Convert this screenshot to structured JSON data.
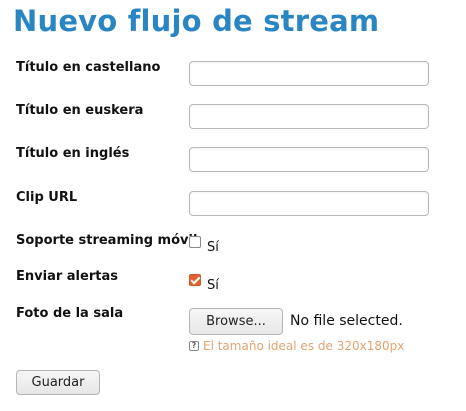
{
  "title": "Nuevo flujo de stream",
  "fields": {
    "titulo_castellano": {
      "label": "Título en castellano",
      "value": ""
    },
    "titulo_euskera": {
      "label": "Título en euskera",
      "value": ""
    },
    "titulo_ingles": {
      "label": "Título en inglés",
      "value": ""
    },
    "clip_url": {
      "label": "Clip URL",
      "value": ""
    }
  },
  "soporte_streaming": {
    "label": "Soporte streaming móvil",
    "option": "Sí",
    "checked": false
  },
  "enviar_alertas": {
    "label": "Enviar alertas",
    "option": "Sí",
    "checked": true
  },
  "foto_sala": {
    "label": "Foto de la sala",
    "browse_label": "Browse...",
    "file_status": "No file selected.",
    "hint_icon": "question-icon",
    "hint": "El tamaño ideal es de 320x180px",
    "hint_color": "#e3a36f"
  },
  "submit_label": "Guardar",
  "colors": {
    "title": "#2a86c3",
    "checkbox_checked": "#e0632f"
  }
}
